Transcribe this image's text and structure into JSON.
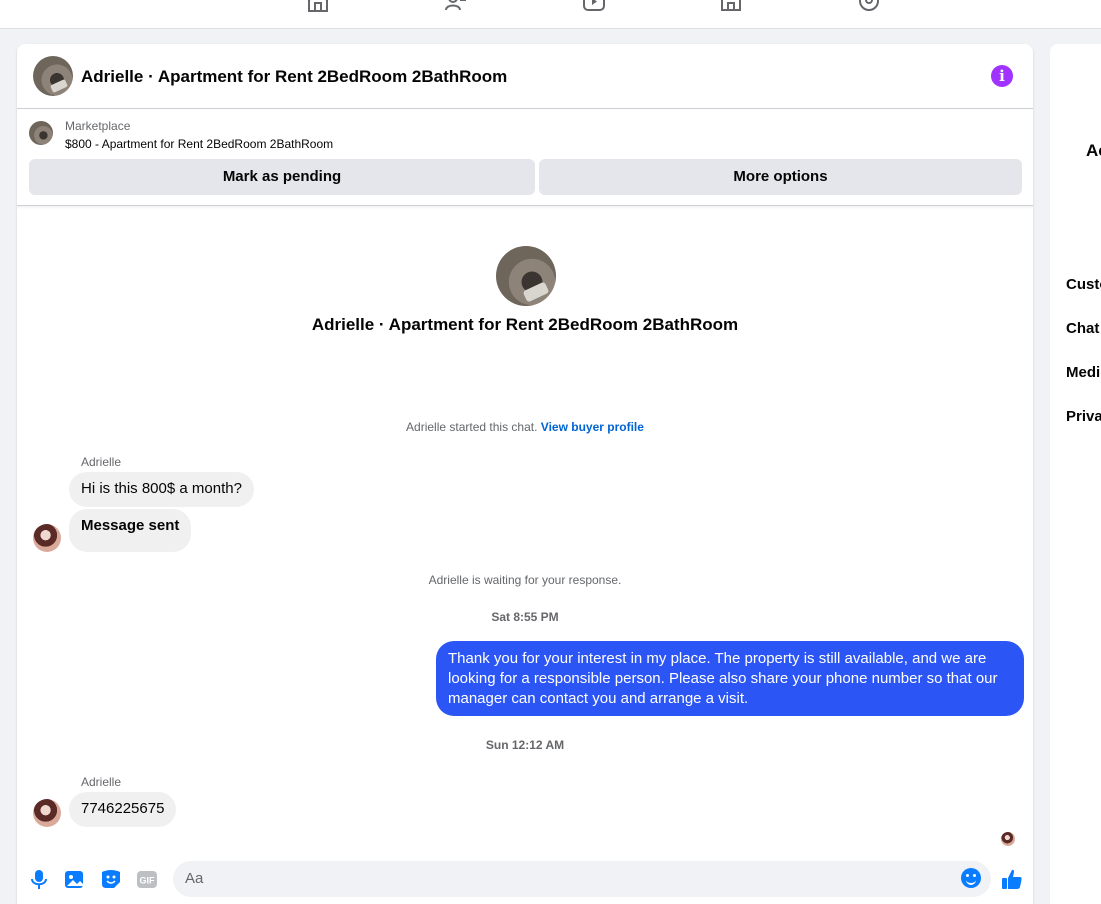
{
  "conversation": {
    "title": "Adrielle · Apartment for Rent 2BedRoom 2BathRoom"
  },
  "marketplace": {
    "label": "Marketplace",
    "listing": "$800 - Apartment for Rent 2BedRoom 2BathRoom",
    "mark_pending_label": "Mark as pending",
    "more_options_label": "More options"
  },
  "profile": {
    "name": "Adrielle · Apartment for Rent 2BedRoom 2BathRoom",
    "started_text": "Adrielle started this chat.",
    "view_profile_link": "View buyer profile"
  },
  "messages": {
    "sender_1": "Adrielle",
    "msg_1": "Hi is this 800$ a month?",
    "msg_2": "Message sent",
    "waiting_text": "Adrielle is waiting for your response.",
    "time_1": "Sat 8:55 PM",
    "outgoing_1": "Thank you for your interest in my place. The property is still available, and we are looking for a responsible person. Please also share your phone number so that our manager can contact you and arrange a visit.",
    "time_2": "Sun 12:12 AM",
    "sender_2": "Adrielle",
    "msg_3": "7746225675"
  },
  "composer": {
    "placeholder": "Aa",
    "icons": [
      "microphone-icon",
      "photo-icon",
      "sticker-icon",
      "gif-icon",
      "emoji-icon",
      "like-icon"
    ]
  },
  "right_panel": {
    "title": "Ac",
    "items": [
      "Custo",
      "Chat",
      "Medi",
      "Priva"
    ]
  },
  "colors": {
    "accent": "#0a7cff",
    "outgoing_bubble": "#2c55f5",
    "info": "#a033ff"
  }
}
